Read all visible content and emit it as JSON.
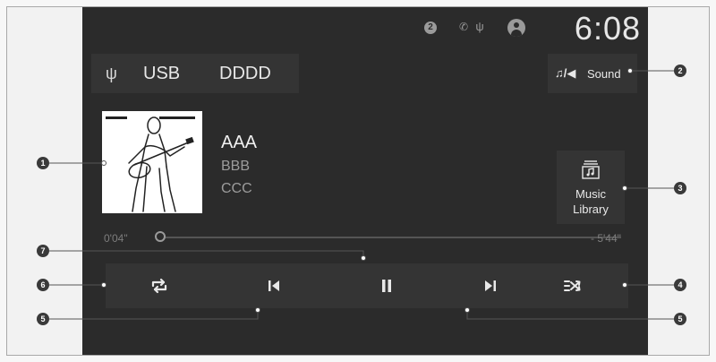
{
  "status_bar": {
    "badge_number": "2",
    "clock": "6:08",
    "icons": [
      "notification-badge-icon",
      "phone-icon",
      "usb-icon",
      "profile-icon"
    ]
  },
  "source": {
    "label": "USB",
    "device": "DDDD",
    "icon": "usb-icon"
  },
  "sound_button": {
    "label": "Sound",
    "icon": "music-speaker-icon"
  },
  "track": {
    "title": "AAA",
    "artist": "BBB",
    "album": "CCC"
  },
  "music_library": {
    "label_line1": "Music",
    "label_line2": "Library",
    "icon": "music-library-icon"
  },
  "progress": {
    "elapsed": "0'04\"",
    "remaining": "- 5'44\"",
    "position_fraction": 0.01
  },
  "controls": [
    "repeat-icon",
    "previous-track-icon",
    "pause-icon",
    "next-track-icon",
    "shuffle-icon"
  ],
  "callouts": [
    "1",
    "2",
    "3",
    "4",
    "5",
    "5",
    "6",
    "7"
  ],
  "colors": {
    "screen_background": "#2b2b2b",
    "panel_background": "#343434",
    "primary_text": "#e8e8e8",
    "secondary_text": "#9c9c9c"
  }
}
